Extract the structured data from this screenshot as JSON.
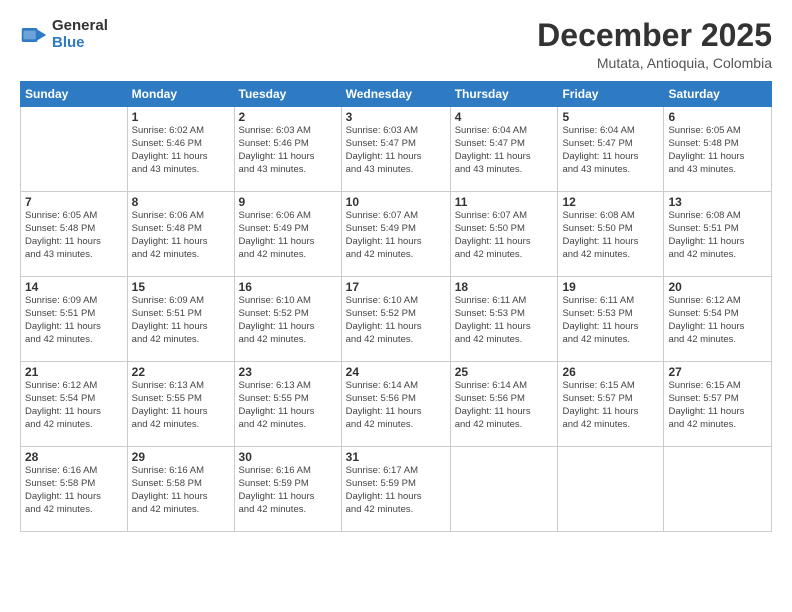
{
  "header": {
    "logo_general": "General",
    "logo_blue": "Blue",
    "month_title": "December 2025",
    "location": "Mutata, Antioquia, Colombia"
  },
  "days_of_week": [
    "Sunday",
    "Monday",
    "Tuesday",
    "Wednesday",
    "Thursday",
    "Friday",
    "Saturday"
  ],
  "weeks": [
    [
      {
        "day": "",
        "info": ""
      },
      {
        "day": "1",
        "info": "Sunrise: 6:02 AM\nSunset: 5:46 PM\nDaylight: 11 hours\nand 43 minutes."
      },
      {
        "day": "2",
        "info": "Sunrise: 6:03 AM\nSunset: 5:46 PM\nDaylight: 11 hours\nand 43 minutes."
      },
      {
        "day": "3",
        "info": "Sunrise: 6:03 AM\nSunset: 5:47 PM\nDaylight: 11 hours\nand 43 minutes."
      },
      {
        "day": "4",
        "info": "Sunrise: 6:04 AM\nSunset: 5:47 PM\nDaylight: 11 hours\nand 43 minutes."
      },
      {
        "day": "5",
        "info": "Sunrise: 6:04 AM\nSunset: 5:47 PM\nDaylight: 11 hours\nand 43 minutes."
      },
      {
        "day": "6",
        "info": "Sunrise: 6:05 AM\nSunset: 5:48 PM\nDaylight: 11 hours\nand 43 minutes."
      }
    ],
    [
      {
        "day": "7",
        "info": "Sunrise: 6:05 AM\nSunset: 5:48 PM\nDaylight: 11 hours\nand 43 minutes."
      },
      {
        "day": "8",
        "info": "Sunrise: 6:06 AM\nSunset: 5:48 PM\nDaylight: 11 hours\nand 42 minutes."
      },
      {
        "day": "9",
        "info": "Sunrise: 6:06 AM\nSunset: 5:49 PM\nDaylight: 11 hours\nand 42 minutes."
      },
      {
        "day": "10",
        "info": "Sunrise: 6:07 AM\nSunset: 5:49 PM\nDaylight: 11 hours\nand 42 minutes."
      },
      {
        "day": "11",
        "info": "Sunrise: 6:07 AM\nSunset: 5:50 PM\nDaylight: 11 hours\nand 42 minutes."
      },
      {
        "day": "12",
        "info": "Sunrise: 6:08 AM\nSunset: 5:50 PM\nDaylight: 11 hours\nand 42 minutes."
      },
      {
        "day": "13",
        "info": "Sunrise: 6:08 AM\nSunset: 5:51 PM\nDaylight: 11 hours\nand 42 minutes."
      }
    ],
    [
      {
        "day": "14",
        "info": "Sunrise: 6:09 AM\nSunset: 5:51 PM\nDaylight: 11 hours\nand 42 minutes."
      },
      {
        "day": "15",
        "info": "Sunrise: 6:09 AM\nSunset: 5:51 PM\nDaylight: 11 hours\nand 42 minutes."
      },
      {
        "day": "16",
        "info": "Sunrise: 6:10 AM\nSunset: 5:52 PM\nDaylight: 11 hours\nand 42 minutes."
      },
      {
        "day": "17",
        "info": "Sunrise: 6:10 AM\nSunset: 5:52 PM\nDaylight: 11 hours\nand 42 minutes."
      },
      {
        "day": "18",
        "info": "Sunrise: 6:11 AM\nSunset: 5:53 PM\nDaylight: 11 hours\nand 42 minutes."
      },
      {
        "day": "19",
        "info": "Sunrise: 6:11 AM\nSunset: 5:53 PM\nDaylight: 11 hours\nand 42 minutes."
      },
      {
        "day": "20",
        "info": "Sunrise: 6:12 AM\nSunset: 5:54 PM\nDaylight: 11 hours\nand 42 minutes."
      }
    ],
    [
      {
        "day": "21",
        "info": "Sunrise: 6:12 AM\nSunset: 5:54 PM\nDaylight: 11 hours\nand 42 minutes."
      },
      {
        "day": "22",
        "info": "Sunrise: 6:13 AM\nSunset: 5:55 PM\nDaylight: 11 hours\nand 42 minutes."
      },
      {
        "day": "23",
        "info": "Sunrise: 6:13 AM\nSunset: 5:55 PM\nDaylight: 11 hours\nand 42 minutes."
      },
      {
        "day": "24",
        "info": "Sunrise: 6:14 AM\nSunset: 5:56 PM\nDaylight: 11 hours\nand 42 minutes."
      },
      {
        "day": "25",
        "info": "Sunrise: 6:14 AM\nSunset: 5:56 PM\nDaylight: 11 hours\nand 42 minutes."
      },
      {
        "day": "26",
        "info": "Sunrise: 6:15 AM\nSunset: 5:57 PM\nDaylight: 11 hours\nand 42 minutes."
      },
      {
        "day": "27",
        "info": "Sunrise: 6:15 AM\nSunset: 5:57 PM\nDaylight: 11 hours\nand 42 minutes."
      }
    ],
    [
      {
        "day": "28",
        "info": "Sunrise: 6:16 AM\nSunset: 5:58 PM\nDaylight: 11 hours\nand 42 minutes."
      },
      {
        "day": "29",
        "info": "Sunrise: 6:16 AM\nSunset: 5:58 PM\nDaylight: 11 hours\nand 42 minutes."
      },
      {
        "day": "30",
        "info": "Sunrise: 6:16 AM\nSunset: 5:59 PM\nDaylight: 11 hours\nand 42 minutes."
      },
      {
        "day": "31",
        "info": "Sunrise: 6:17 AM\nSunset: 5:59 PM\nDaylight: 11 hours\nand 42 minutes."
      },
      {
        "day": "",
        "info": ""
      },
      {
        "day": "",
        "info": ""
      },
      {
        "day": "",
        "info": ""
      }
    ]
  ]
}
